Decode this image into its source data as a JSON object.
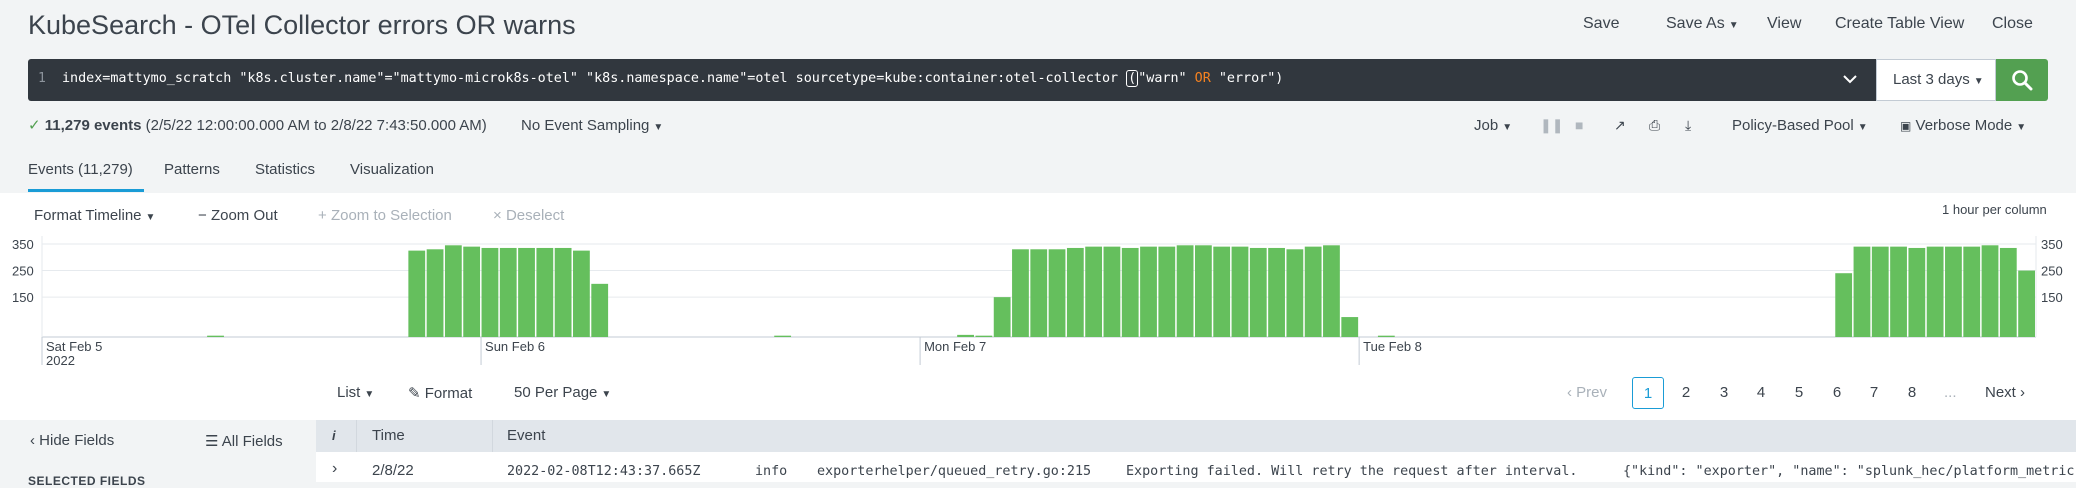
{
  "header": {
    "title": "KubeSearch - OTel Collector errors OR warns",
    "save": "Save",
    "save_as": "Save As",
    "view": "View",
    "create_table_view": "Create Table View",
    "close": "Close"
  },
  "search": {
    "line_number": "1",
    "query_before": "index=mattymo_scratch \"k8s.cluster.name\"=\"mattymo-microk8s-otel\" \"k8s.namespace.name\"=otel sourcetype=kube:container:otel-collector ",
    "query_paren": "(",
    "query_warn": "\"warn\"",
    "query_or": "OR",
    "query_after": "\"error\")",
    "time_range": "Last 3 days"
  },
  "status": {
    "event_count": "11,279 events",
    "time_span": "(2/5/22 12:00:00.000 AM to 2/8/22 7:43:50.000 AM)",
    "sampling": "No Event Sampling",
    "job": "Job",
    "pool": "Policy-Based Pool",
    "mode": "Verbose Mode"
  },
  "tabs": [
    "Events (11,279)",
    "Patterns",
    "Statistics",
    "Visualization"
  ],
  "timeline_controls": {
    "format_timeline": "Format Timeline",
    "zoom_out": "Zoom Out",
    "zoom_selection": "Zoom to Selection",
    "deselect": "Deselect",
    "scale_note": "1 hour per column"
  },
  "chart_data": {
    "type": "bar",
    "y_ticks": [
      "350",
      "250",
      "150"
    ],
    "ylim": [
      0,
      380
    ],
    "x_labels": [
      "Sat Feb 5",
      "2022",
      "Sun Feb 6",
      "Mon Feb 7",
      "Tue Feb 8"
    ],
    "bar_color": "#65bf5d",
    "values": [
      0,
      0,
      0,
      0,
      0,
      0,
      0,
      0,
      0,
      5,
      0,
      0,
      0,
      0,
      0,
      0,
      0,
      0,
      0,
      0,
      325,
      330,
      345,
      340,
      335,
      335,
      335,
      335,
      335,
      325,
      200,
      0,
      0,
      0,
      0,
      0,
      0,
      0,
      0,
      0,
      5,
      0,
      0,
      0,
      0,
      0,
      0,
      0,
      0,
      0,
      8,
      5,
      150,
      330,
      330,
      330,
      335,
      340,
      340,
      335,
      340,
      340,
      345,
      345,
      340,
      340,
      335,
      335,
      330,
      340,
      345,
      75,
      0,
      5,
      0,
      0,
      0,
      0,
      0,
      0,
      0,
      0,
      0,
      0,
      0,
      0,
      0,
      0,
      0,
      0,
      0,
      0,
      0,
      0,
      0,
      0,
      0,
      0,
      240,
      340,
      340,
      340,
      335,
      340,
      340,
      340,
      345,
      335,
      250
    ]
  },
  "results": {
    "list": "List",
    "format": "Format",
    "per_page": "50 Per Page",
    "prev": "Prev",
    "pages": [
      "1",
      "2",
      "3",
      "4",
      "5",
      "6",
      "7",
      "8"
    ],
    "ellipsis": "...",
    "next": "Next"
  },
  "fields": {
    "hide": "Hide Fields",
    "all": "All Fields",
    "selected": "SELECTED FIELDS"
  },
  "table": {
    "col_info": "i",
    "col_time": "Time",
    "col_event": "Event",
    "rows": [
      {
        "time": "2/8/22",
        "timestamp": "2022-02-08T12:43:37.665Z",
        "level": "info",
        "source": "exporterhelper/queued_retry.go:215",
        "message": "Exporting failed. Will retry the request after interval.",
        "json": "{\"kind\": \"exporter\", \"name\": \"splunk_hec/platform_metric"
      }
    ]
  },
  "colors": {
    "accent": "#1a9cd6",
    "search_green": "#53a051",
    "bar_green": "#65bf5d",
    "dark": "#31373e",
    "keyword": "#f58220"
  }
}
